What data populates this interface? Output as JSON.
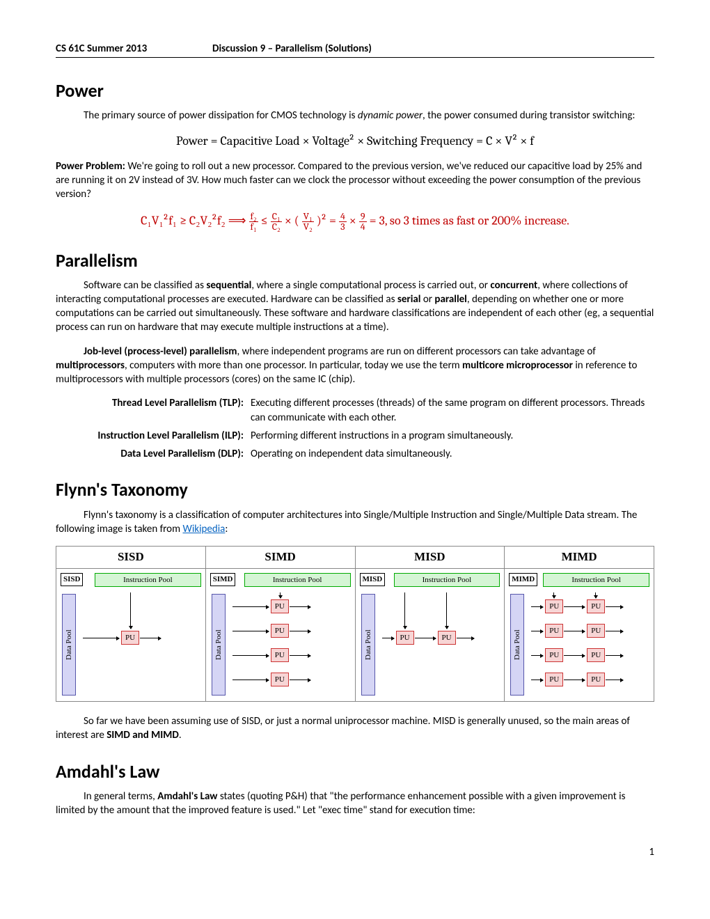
{
  "header": {
    "course": "CS 61C Summer 2013",
    "title": "Discussion 9 – Parallelism (Solutions)"
  },
  "power": {
    "heading": "Power",
    "intro_a": "The primary source of power dissipation for CMOS technology is ",
    "intro_em": "dynamic power",
    "intro_b": ", the power consumed during transistor switching:",
    "formula": "Power = Capacitive Load × Voltage² × Switching Frequency = C × V² × f",
    "problem_label": "Power Problem:",
    "problem_text": "  We're going to roll out a new processor.  Compared to the previous version, we've reduced our capacitive load by 25% and are running it on 2V instead of 3V.  How much faster can we clock the processor without exceeding the power consumption of the previous version?",
    "answer_a": "C₁V₁²f₁ ≥ C₂V₂²f₂   ⟹  ",
    "answer_b": "f₂",
    "answer_c": "f₁",
    "answer_d": " ≤ ",
    "answer_e": "C₁",
    "answer_f": "C₂",
    "answer_g": " × (",
    "answer_h": "V₁",
    "answer_i": "V₂",
    "answer_j": ")² = ",
    "answer_k": "4",
    "answer_l": "3",
    "answer_m": " × ",
    "answer_n": "9",
    "answer_o": "4",
    "answer_p": " = 3, so 3 times as fast or 200% increase."
  },
  "parallelism": {
    "heading": "Parallelism",
    "p1_a": "Software can be classified as ",
    "p1_b": "sequential",
    "p1_c": ", where a single computational process is carried out, or ",
    "p1_d": "concurrent",
    "p1_e": ", where collections of interacting computational processes are executed.  Hardware can be classified as ",
    "p1_f": "serial",
    "p1_g": " or ",
    "p1_h": "parallel",
    "p1_i": ", depending on whether one or more computations can be carried out simultaneously.  These software and hardware classifications are independent of each other (eg, a sequential process can run on hardware that may execute multiple instructions at a time).",
    "p2_a": "Job-level (process-level) parallelism",
    "p2_b": ", where independent programs are run on different processors can take advantage of ",
    "p2_c": "multiprocessors",
    "p2_d": ", computers with more than one processor.  In particular, today we use the term ",
    "p2_e": "multicore microprocessor",
    "p2_f": " in reference to multiprocessors with multiple processors (cores) on the same IC (chip).",
    "defs": {
      "tlp_label": "Thread Level Parallelism (TLP):",
      "tlp_text": "Executing different processes (threads) of the same program on different processors.  Threads can communicate with each other.",
      "ilp_label": "Instruction Level Parallelism (ILP):",
      "ilp_text": "Performing different instructions in a program simultaneously.",
      "dlp_label": "Data Level Parallelism (DLP):",
      "dlp_text": "Operating on independent data simultaneously."
    }
  },
  "flynn": {
    "heading": "Flynn's Taxonomy",
    "intro_a": "Flynn's taxonomy is a classification of computer architectures into Single/Multiple Instruction and Single/Multiple Data stream.  The following image is taken from ",
    "intro_link": "Wikipedia",
    "intro_b": ":",
    "titles": {
      "sisd": "SISD",
      "simd": "SIMD",
      "misd": "MISD",
      "mimd": "MIMD"
    },
    "labels": {
      "instr": "Instruction Pool",
      "data": "Data Pool",
      "pu": "PU"
    },
    "after_a": "So far we have been assuming use of SISD, or just a normal uniprocessor machine.  MISD is generally unused, so the main areas of interest are ",
    "after_b": "SIMD and MIMD",
    "after_c": "."
  },
  "amdahl": {
    "heading": "Amdahl's Law",
    "p_a": "In general terms, ",
    "p_b": "Amdahl's Law",
    "p_c": " states (quoting P&H) that \"the performance enhancement possible with a given improvement is limited by the amount that the improved feature is used.\"  Let \"exec time\" stand for execution time:"
  },
  "page_number": "1",
  "chart_data": [
    {
      "type": "diagram",
      "label": "SISD",
      "instruction_streams": 1,
      "data_streams": 1,
      "pu_count": 1
    },
    {
      "type": "diagram",
      "label": "SIMD",
      "instruction_streams": 1,
      "data_streams": 4,
      "pu_count": 4
    },
    {
      "type": "diagram",
      "label": "MISD",
      "instruction_streams": 2,
      "data_streams": 1,
      "pu_count": 2
    },
    {
      "type": "diagram",
      "label": "MIMD",
      "instruction_streams": 2,
      "data_streams": 4,
      "pu_count": 8
    }
  ]
}
